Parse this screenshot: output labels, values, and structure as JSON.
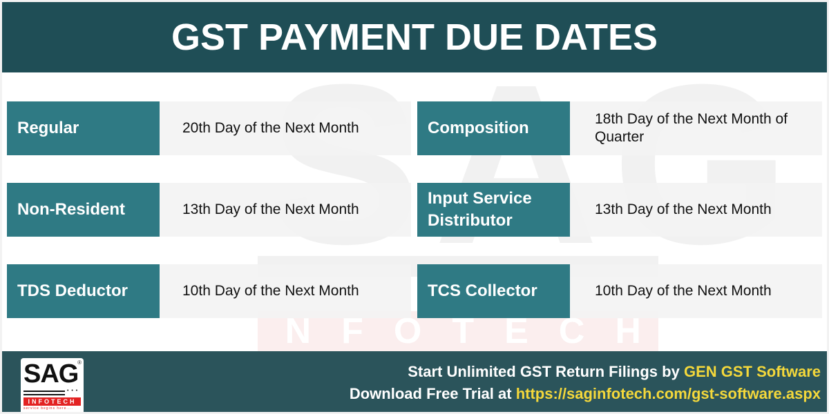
{
  "header": {
    "title": "GST PAYMENT DUE DATES"
  },
  "watermark": {
    "brand": "SAG",
    "sub": "INFOTECH"
  },
  "left_rows": [
    {
      "label": "Regular",
      "value": "20th Day of the Next Month"
    },
    {
      "label": "Non-Resident",
      "value": "13th Day of the Next Month"
    },
    {
      "label": "TDS Deductor",
      "value": "10th Day of the Next Month"
    }
  ],
  "right_rows": [
    {
      "label": "Composition",
      "value": "18th Day of the Next Month of Quarter"
    },
    {
      "label": "Input Service Distributor",
      "value": "13th Day of the Next Month"
    },
    {
      "label": "TCS Collector",
      "value": "10th Day of the Next Month"
    }
  ],
  "footer": {
    "logo": {
      "brand": "SAG",
      "registered": "®",
      "sub": "INFOTECH",
      "tagline": "service begins here....",
      "dots": "• • •"
    },
    "line1_prefix": "Start Unlimited GST Return Filings by ",
    "line1_highlight": "GEN GST Software",
    "line2_prefix": "Download Free Trial at ",
    "line2_link": "https://saginfotech.com/gst-software.aspx"
  },
  "colors": {
    "header_bg": "#1f4e56",
    "label_bg": "#2f7a84",
    "value_bg": "#f3f3f3",
    "footer_bg": "#2b545b",
    "highlight": "#f4d83b",
    "logo_red": "#e32222"
  }
}
